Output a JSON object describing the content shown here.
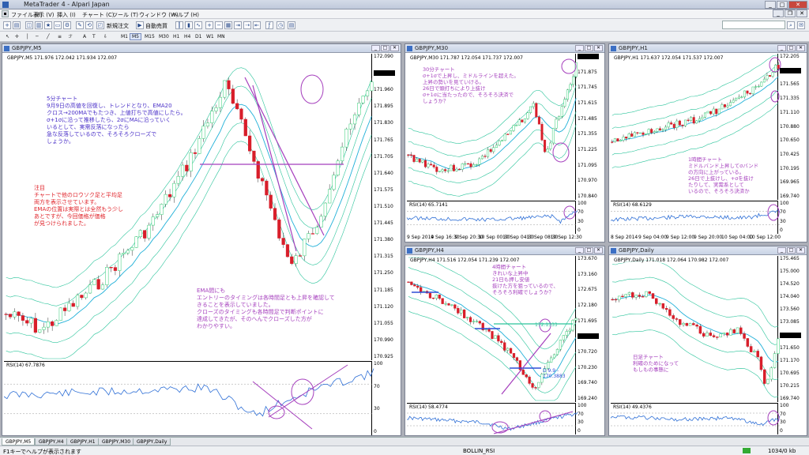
{
  "window": {
    "title": "MetaTrader 4 - Alpari Japan"
  },
  "menu": [
    "ファイル (F)",
    "表示 (V)",
    "挿入 (I)",
    "チャート (C)",
    "ツール (T)",
    "ウィンドウ (W)",
    "ヘルプ (H)"
  ],
  "toolbar": {
    "new_order": "新規注文",
    "auto_trading": "自動売買"
  },
  "timeframes": [
    "M1",
    "M5",
    "M15",
    "M30",
    "H1",
    "H4",
    "D1",
    "W1",
    "MN"
  ],
  "active_timeframe": "M5",
  "charts": {
    "m5": {
      "title": "GBPJPY,M5",
      "info": "GBPJPY,M5 171.976 172.042 171.934 172.007",
      "price_labels": [
        "172.090",
        "172.025",
        "171.960",
        "171.895",
        "171.830",
        "171.765",
        "171.705",
        "171.640",
        "171.575",
        "171.510",
        "171.445",
        "171.380",
        "171.315",
        "171.250",
        "171.185",
        "171.120",
        "171.055",
        "170.990",
        "170.925"
      ],
      "current_price": "172.007",
      "rsi_label": "RSI(14) 67.7876",
      "rsi_levels": [
        "100",
        "70",
        "30",
        "0"
      ]
    },
    "m30": {
      "title": "GBPJPY,M30",
      "info": "GBPJPY,M30 171.787 172.054 171.737 172.007",
      "price_labels": [
        "172.007",
        "171.875",
        "171.745",
        "171.615",
        "171.485",
        "171.355",
        "171.225",
        "171.095",
        "170.970",
        "170.840"
      ],
      "current_price": "172.007",
      "rsi_label": "RSI(14) 65.7141",
      "rsi_levels": [
        "100",
        "70",
        "30",
        "0"
      ],
      "x_labels": [
        "9 Sep 2014",
        "9 Sep 16:30",
        "9 Sep 20:30",
        "10 Sep 00:30",
        "10 Sep 04:30",
        "10 Sep 08:30",
        "10 Sep 12:30"
      ]
    },
    "h1": {
      "title": "GBPJPY,H1",
      "info": "GBPJPY,H1 171.637 172.054 171.537 172.007",
      "price_labels": [
        "172.205",
        "172.007",
        "171.565",
        "171.335",
        "171.110",
        "170.880",
        "170.650",
        "170.425",
        "170.195",
        "169.965",
        "169.740"
      ],
      "current_price": "172.007",
      "rsi_label": "RSI(14) 68.6129",
      "rsi_levels": [
        "100",
        "70",
        "30",
        "0"
      ],
      "x_labels": [
        "8 Sep 2014",
        "9 Sep 04:00",
        "9 Sep 12:00",
        "9 Sep 20:00",
        "10 Sep 04:00",
        "10 Sep 12:00"
      ]
    },
    "h4": {
      "title": "GBPJPY,H4",
      "info": "GBPJPY,H4 171.516 172.054 171.239 172.007",
      "price_labels": [
        "173.670",
        "173.160",
        "172.675",
        "172.180",
        "171.695",
        "171.210",
        "170.720",
        "170.230",
        "169.740",
        "169.240"
      ],
      "current_price": "172.007",
      "line_label_1": "172.1333",
      "line_label_2": "D 9.9 - 170.3883",
      "rsi_label": "RSI(14) 58.4774",
      "rsi_levels": [
        "100",
        "70",
        "30",
        "0"
      ]
    },
    "daily": {
      "title": "GBPJPY,Daily",
      "info": "GBPJPY,Daily 171.018 172.064 170.982 172.007",
      "price_labels": [
        "175.465",
        "175.000",
        "174.520",
        "174.040",
        "173.560",
        "173.085",
        "172.007",
        "171.650",
        "171.170",
        "170.695",
        "170.215",
        "169.740"
      ],
      "current_price": "172.007",
      "rsi_label": "RSI(14) 49.4376",
      "rsi_levels": [
        "100",
        "70",
        "30",
        "0"
      ]
    }
  },
  "notes": {
    "m5_blue": "5分チャート\n9月9日の高値を回復し、トレンドとなり、EMA20\nクロス→200MAでもたつき、上値打ちで高値にしたら。\nσ+1σに沿って推移したら、2σにMAに沿っていく\nいるとして、実需反落になったら\n急な反落しているので、そろそろクローズで\nしょうか。",
    "m5_red": "注目\nチャートで他のロウソク足と平均足\n両方を表示させています。\nEMAの位置は実際とは全然もう少し\nあとですが、今回価格が価格\nが見つけられました。",
    "m5_purple": "EMA間にも\nエントリーのタイミングは各時間足とも上昇を確認して\nきることを表示していました。\nクローズのタイミングも各時間足で判断ポイントに\n達成してきたが、そのへんでクローズした方が\nわかりやすい。",
    "m30_purple": "30分チャート\nσ+1σで上昇し、ミドルラインを超えた。\n上昇の勢いを見ていける。\n26日で頭打ちにより上抜け\nσ+1σに当たったので、そろそろ決済で\nしょうか？",
    "h1_purple": "1時間チャート\nミドルバンド上昇してσバンド\nの方向に上がっている。\n26日で上抜けし、+σを抜け\nたりして、実需系として\nいるので、そろそろ決済か",
    "h4_purple": "4時間チャート\nきれいな上昇中\n21日も押し安値\n抜けた方を狙っているので、\nそろそろ利確でしょうか？",
    "daily_purple": "日足チャート\n利確のためになって\nもしもの事態に"
  },
  "tabs": [
    "GBPJPY,M5",
    "GBPJPY,H4",
    "GBPJPY,H1",
    "GBPJPY,M30",
    "GBPJPY,Daily"
  ],
  "status": {
    "help": "F1キーでヘルプが表示されます",
    "profile": "BOLLIN_RSI",
    "kb": "1034/0 kb"
  },
  "colors": {
    "bull": "#2ecc71",
    "bear": "#d81e2a",
    "bb": "#2bc49b",
    "rsi": "#2e6fd6",
    "annot": "#a53fbd"
  }
}
